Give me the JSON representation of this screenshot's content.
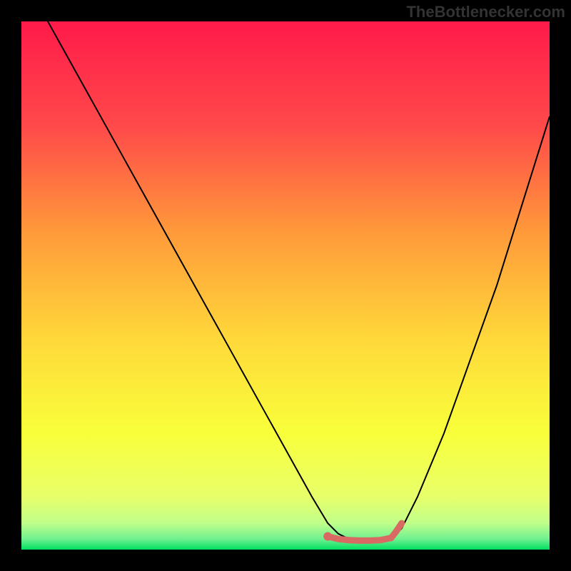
{
  "watermark": "TheBottlenecker.com",
  "chart_data": {
    "type": "line",
    "title": "",
    "xlabel": "",
    "ylabel": "",
    "xlim": [
      0,
      100
    ],
    "ylim": [
      0,
      100
    ],
    "series": [
      {
        "name": "curve",
        "x": [
          0,
          5,
          10,
          15,
          20,
          25,
          30,
          35,
          40,
          45,
          50,
          55,
          58,
          60,
          62,
          65,
          68,
          70,
          72,
          75,
          80,
          85,
          90,
          95,
          100
        ],
        "y": [
          108,
          100,
          91,
          82,
          73,
          64,
          55,
          46,
          37,
          28,
          19,
          10,
          5,
          3,
          2,
          1.5,
          1.5,
          2,
          4,
          10,
          22,
          36,
          50,
          66,
          82
        ]
      },
      {
        "name": "flat-region",
        "x": [
          58,
          60,
          62,
          64,
          66,
          68,
          70,
          71,
          72
        ],
        "y": [
          2.5,
          2,
          1.8,
          1.7,
          1.7,
          1.8,
          2.2,
          3.5,
          5
        ]
      }
    ],
    "colors": {
      "curve": "#000000",
      "flat_region": "#d96a63",
      "gradient_top": "#ff1a4a",
      "gradient_mid1": "#ff7a3a",
      "gradient_mid2": "#ffd83a",
      "gradient_mid3": "#f8ff3a",
      "gradient_bottom": "#00e060"
    }
  }
}
